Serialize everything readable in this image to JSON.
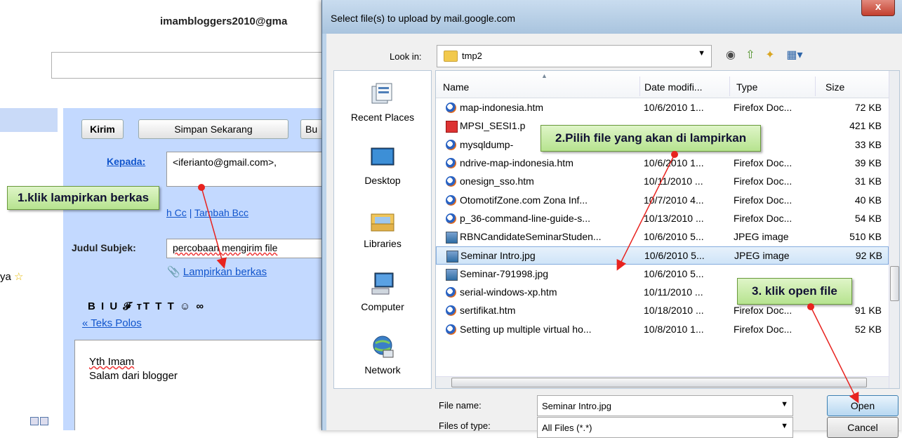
{
  "gmail": {
    "account": "imambloggers2010@gma",
    "buttons": {
      "send": "Kirim",
      "save": "Simpan Sekarang",
      "discard": "Bu"
    },
    "to_label": "Kepada:",
    "to_value": "<iferianto@gmail.com>,",
    "cc_link": "h Cc",
    "bcc_link": "Tambah Bcc",
    "separator": "|",
    "subject_label": "Judul Subjek:",
    "subject_value": "percobaan mengirim file",
    "attach_link": "Lampirkan berkas",
    "left_text": "ya",
    "format_bar": "B I U 𝓕 тT T T ☺ ∞",
    "plain_text_link": "« Teks Polos",
    "body_line1": "Yth Imam",
    "body_line2": "Salam dari blogger"
  },
  "dialog": {
    "title": "Select file(s) to upload by mail.google.com",
    "close": "x",
    "look_in_label": "Look in:",
    "look_in_value": "tmp2",
    "places": [
      "Recent Places",
      "Desktop",
      "Libraries",
      "Computer",
      "Network"
    ],
    "columns": {
      "name": "Name",
      "date": "Date modifi...",
      "type": "Type",
      "size": "Size"
    },
    "files": [
      {
        "name": "map-indonesia.htm",
        "date": "10/6/2010 1...",
        "type": "Firefox Doc...",
        "size": "72 KB",
        "icon": "ffx"
      },
      {
        "name": "MPSI_SESI1.p",
        "date": "",
        "type": "",
        "size": "421 KB",
        "icon": "pdf"
      },
      {
        "name": "mysqldump-",
        "date": "",
        "type": "",
        "size": "33 KB",
        "icon": "ffx"
      },
      {
        "name": "ndrive-map-indonesia.htm",
        "date": "10/6/2010 1...",
        "type": "Firefox Doc...",
        "size": "39 KB",
        "icon": "ffx"
      },
      {
        "name": "onesign_sso.htm",
        "date": "10/11/2010 ...",
        "type": "Firefox Doc...",
        "size": "31 KB",
        "icon": "ffx"
      },
      {
        "name": "OtomotifZone.com  Zona Inf...",
        "date": "10/7/2010 4...",
        "type": "Firefox Doc...",
        "size": "40 KB",
        "icon": "ffx"
      },
      {
        "name": "p_36-command-line-guide-s...",
        "date": "10/13/2010 ...",
        "type": "Firefox Doc...",
        "size": "54 KB",
        "icon": "ffx"
      },
      {
        "name": "RBNCandidateSeminarStuden...",
        "date": "10/6/2010 5...",
        "type": "JPEG image",
        "size": "510 KB",
        "icon": "jpg"
      },
      {
        "name": "Seminar Intro.jpg",
        "date": "10/6/2010 5...",
        "type": "JPEG image",
        "size": "92 KB",
        "icon": "jpg",
        "selected": true
      },
      {
        "name": "Seminar-791998.jpg",
        "date": "10/6/2010 5...",
        "type": "",
        "size": "",
        "icon": "jpg"
      },
      {
        "name": "serial-windows-xp.htm",
        "date": "10/11/2010 ...",
        "type": "",
        "size": "",
        "icon": "ffx"
      },
      {
        "name": "sertifikat.htm",
        "date": "10/18/2010 ...",
        "type": "Firefox Doc...",
        "size": "91 KB",
        "icon": "ffx"
      },
      {
        "name": "Setting up multiple virtual ho...",
        "date": "10/8/2010 1...",
        "type": "Firefox Doc...",
        "size": "52 KB",
        "icon": "ffx"
      }
    ],
    "file_name_label": "File name:",
    "file_name_value": "Seminar Intro.jpg",
    "files_of_type_label": "Files of type:",
    "files_of_type_value": "All Files (*.*)",
    "open_button": "Open",
    "cancel_button": "Cancel"
  },
  "annotations": {
    "step1": "1.klik lampirkan berkas",
    "step2": "2.Pilih file yang akan di lampirkan",
    "step3": "3. klik open file",
    "arrow_color": "#e8231f"
  }
}
